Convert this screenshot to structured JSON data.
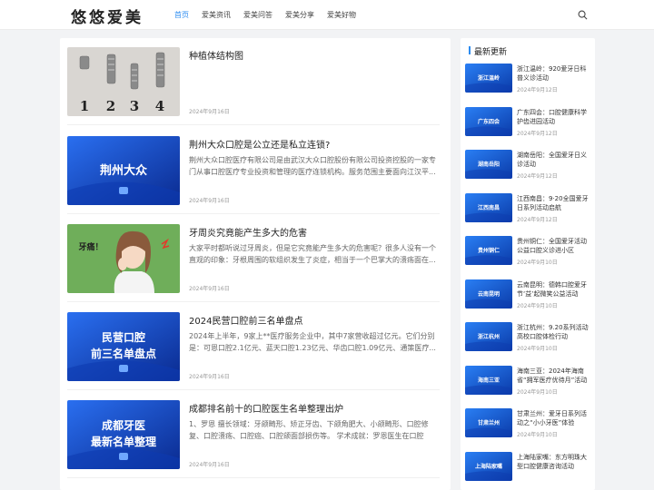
{
  "header": {
    "logo": "悠悠爱美",
    "nav": [
      {
        "label": "首页",
        "active": true
      },
      {
        "label": "爱美资讯",
        "active": false
      },
      {
        "label": "爱美问答",
        "active": false
      },
      {
        "label": "爱美分享",
        "active": false
      },
      {
        "label": "爱美好物",
        "active": false
      }
    ],
    "search_icon": "search-icon"
  },
  "articles": [
    {
      "title": "种植体结构图",
      "excerpt": "",
      "date": "2024年9月16日",
      "thumb_numbers": [
        "1",
        "2",
        "3",
        "4"
      ]
    },
    {
      "title": "荆州大众口腔是公立还是私立连锁?",
      "excerpt": "荆州大众口腔医疗有限公司是由武汉大众口腔股份有限公司投资控股的一家专门从事口腔医疗专业投资和管理的医疗连锁机构。服务范围主要面向江汉平...",
      "date": "2024年9月16日",
      "thumb_text": [
        "荆州大众"
      ]
    },
    {
      "title": "牙周炎究竟能产生多大的危害",
      "excerpt": "大家平时都听说过牙周炎，但是它究竟能产生多大的危害呢？很多人没有一个直观的印象：牙根周围的软组织发生了炎症，相当于一个巴掌大的溃疡面在...",
      "date": "2024年9月16日",
      "thumb_text": [
        "牙痛！"
      ]
    },
    {
      "title": "2024民营口腔前三名单盘点",
      "excerpt": "2024年上半年，9家上**医疗服务企业中，其中7家营收超过亿元。它们分别是：可恩口腔2.1亿元、蓝天口腔1.23亿元、华齿口腔1.09亿元、通策医疗...",
      "date": "2024年9月16日",
      "thumb_text": [
        "民营口腔",
        "前三名单盘点"
      ]
    },
    {
      "title": "成都排名前十的口腔医生名单整理出炉",
      "excerpt": "1、罗恩 擅长领域：牙颌畸形、矫正牙齿、下颌角肥大、小颌畸形、口腔修复、口腔溃疡、口腔癌、口腔颌面部损伤等。 学术成就：罗恩医生在口腔医...",
      "date": "2024年9月16日",
      "thumb_text": [
        "成都牙医",
        "最新名单整理"
      ]
    }
  ],
  "sidebar": {
    "title": "最新更新",
    "items": [
      {
        "thumb": "浙江温岭",
        "title": "浙江温岭：920爱牙日科普义诊活动",
        "date": "2024年9月12日"
      },
      {
        "thumb": "广东四会",
        "title": "广东四会：口腔健康科学护齿进园活动",
        "date": "2024年9月12日"
      },
      {
        "thumb": "湖南岳阳",
        "title": "湖南岳阳：全国爱牙日义诊活动",
        "date": "2024年9月12日"
      },
      {
        "thumb": "江西南昌",
        "title": "江西南昌：9·20全国爱牙日系列活动启航",
        "date": "2024年9月12日"
      },
      {
        "thumb": "贵州铜仁",
        "title": "贵州铜仁：全国爱牙活动公益口腔义诊进小区",
        "date": "2024年9月10日"
      },
      {
        "thumb": "云南昆明",
        "title": "云南昆明：德韩口腔爱牙节‘益’起微笑公益活动",
        "date": "2024年9月10日"
      },
      {
        "thumb": "浙江杭州",
        "title": "浙江杭州：9.20系列活动高校口腔体检行动",
        "date": "2024年9月10日"
      },
      {
        "thumb": "海南三亚",
        "title": "海南三亚：2024年海南省“拥军医疗优待月”活动",
        "date": "2024年9月10日"
      },
      {
        "thumb": "甘肃兰州",
        "title": "甘肃兰州：爱牙日系列活动之“小小牙医”体验",
        "date": "2024年9月10日"
      },
      {
        "thumb": "上海陆家嘴",
        "title": "上海陆家嘴：东方明珠大型口腔健康咨询活动",
        "date": ""
      }
    ]
  },
  "colors": {
    "accent": "#2d8cf0",
    "thumb_blue": "#1a5fd6",
    "thumb_dark": "#0a2a8f"
  }
}
